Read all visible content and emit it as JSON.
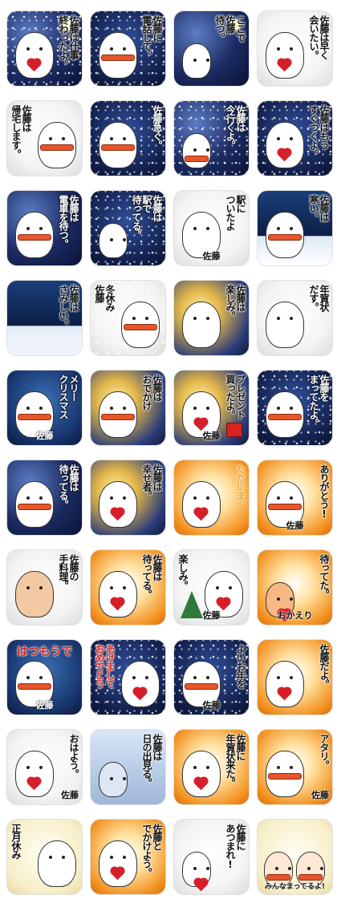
{
  "stickers": [
    {
      "text": "佐藤は仕事\n終わったよ。",
      "bg": "night",
      "pos": "tr",
      "char": "left"
    },
    {
      "text": "佐藤に\n電話して。",
      "bg": "snow",
      "pos": "tr",
      "char": "left"
    },
    {
      "text": "ここで\n佐藤\n待つ。",
      "bg": "night",
      "pos": "tr",
      "char": "left"
    },
    {
      "text": "佐藤は早く\n会いたい。",
      "bg": "pale",
      "pos": "tr",
      "char": "left"
    },
    {
      "text": "佐藤は\n帰宅します。",
      "bg": "pale",
      "pos": "tl",
      "char": "right"
    },
    {
      "text": "佐藤急ぐ。",
      "bg": "snow",
      "pos": "tr",
      "char": "left"
    },
    {
      "text": "佐藤は\n今行くよ。",
      "bg": "night",
      "pos": "tr",
      "char": "left"
    },
    {
      "text": "佐藤はもう\nすぐつくよ。",
      "bg": "snow",
      "pos": "tr",
      "char": "left"
    },
    {
      "text": "佐藤は\n電車を待つ。",
      "bg": "night",
      "pos": "tr",
      "char": "left"
    },
    {
      "text": "佐藤は\n駅で\n待ってる。",
      "bg": "snow",
      "pos": "tr",
      "char": "left"
    },
    {
      "text": "駅に\nついたよ",
      "bg": "pale",
      "pos": "tr",
      "char": "left",
      "label": "佐藤"
    },
    {
      "text": "佐藤は\n寒い。",
      "bg": "window",
      "pos": "tr",
      "char": "left"
    },
    {
      "text": "佐藤は\nさみしい。",
      "bg": "window",
      "pos": "tr",
      "char": "none"
    },
    {
      "text": "冬休み\n佐藤",
      "bg": "pale",
      "pos": "tl",
      "char": "right"
    },
    {
      "text": "佐藤は\n楽しみ。",
      "bg": "lights",
      "pos": "tr",
      "char": "left"
    },
    {
      "text": "年賀状\nだす。",
      "bg": "pale",
      "pos": "tr",
      "char": "left"
    },
    {
      "text": "メリー\nクリスマス",
      "bg": "xmas",
      "pos": "tr",
      "char": "left",
      "label": "佐藤"
    },
    {
      "text": "佐藤は\nおでかけ",
      "bg": "lights",
      "pos": "tr",
      "char": "left"
    },
    {
      "text": "プレゼント\n買ったよ。",
      "bg": "lights",
      "pos": "tr",
      "char": "left",
      "label": "佐藤"
    },
    {
      "text": "佐藤を\nまってたよ。",
      "bg": "snow",
      "pos": "tr",
      "char": "left"
    },
    {
      "text": "佐藤は\n待ってる。",
      "bg": "night",
      "pos": "tr",
      "char": "left"
    },
    {
      "text": "佐藤は\n幸せ者。",
      "bg": "lights",
      "pos": "tr",
      "char": "left"
    },
    {
      "text": "ただいま。",
      "bg": "warm",
      "pos": "tr",
      "char": "left"
    },
    {
      "text": "ありがとう!",
      "bg": "warm",
      "pos": "tr",
      "char": "left",
      "label": "佐藤"
    },
    {
      "text": "佐藤の\n手料理。",
      "bg": "pale",
      "pos": "tr",
      "char": "left"
    },
    {
      "text": "佐藤は\n待ってる。",
      "bg": "warm",
      "pos": "tr",
      "char": "left"
    },
    {
      "text": "楽しみ。",
      "bg": "pale",
      "pos": "tl",
      "char": "right",
      "label": "佐藤"
    },
    {
      "text": "待ってた。",
      "bg": "warm",
      "pos": "tr",
      "char": "left",
      "label": "おかえり"
    },
    {
      "text": "はつもうで",
      "bg": "xmas",
      "pos": "top",
      "char": "left",
      "label": "佐藤"
    },
    {
      "text": "あけまして\nおめでとう",
      "bg": "snow",
      "pos": "tl",
      "char": "right"
    },
    {
      "text": "よいお年を",
      "bg": "snow",
      "pos": "tr",
      "char": "left",
      "label": "佐藤"
    },
    {
      "text": "佐藤だよ。",
      "bg": "warm",
      "pos": "tr",
      "char": "left"
    },
    {
      "text": "おはよう。",
      "bg": "pale",
      "pos": "tr",
      "char": "left",
      "label": "佐藤"
    },
    {
      "text": "佐藤は\n日の出見る。",
      "bg": "cold",
      "pos": "tr",
      "char": "left"
    },
    {
      "text": "佐藤に\n年賀状来た。",
      "bg": "warm",
      "pos": "tr",
      "char": "left"
    },
    {
      "text": "アタリ。",
      "bg": "warm",
      "pos": "tr",
      "char": "left",
      "label": "佐藤"
    },
    {
      "text": "正月休み",
      "bg": "cream",
      "pos": "tl",
      "char": "right"
    },
    {
      "text": "佐藤と\nでかけよう。",
      "bg": "warm",
      "pos": "tr",
      "char": "left"
    },
    {
      "text": "佐藤に\nあつまれ!",
      "bg": "pale",
      "pos": "tr",
      "char": "left"
    },
    {
      "text": "みんなまってるよ!",
      "bg": "cream",
      "pos": "bottom",
      "char": "left"
    }
  ]
}
